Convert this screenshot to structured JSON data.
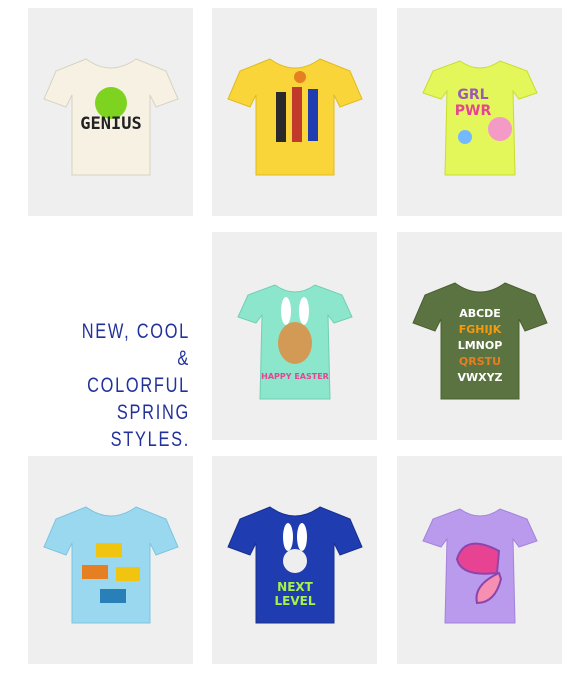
{
  "promo": {
    "line1": "NEW, COOL &",
    "line2": "COLORFUL",
    "line3": "SPRING STYLES."
  },
  "products": [
    {
      "name": "genius-tee",
      "color": "#f6f1e3",
      "graphic_text": "GENIUS"
    },
    {
      "name": "basketball-tee",
      "color": "#f9d53a"
    },
    {
      "name": "girl-pwr-tee",
      "color": "#e4f75a",
      "graphic_text": [
        "GRL",
        "PWR"
      ]
    },
    {
      "name": "happy-easter-cat-tee",
      "color": "#8ce6cc",
      "graphic_text": "HAPPY EASTER"
    },
    {
      "name": "alphabet-trucks-tee",
      "color": "#5a7340",
      "graphic_text": [
        "ABCDE",
        "FGHIJK",
        "LMNOP",
        "QRSTU",
        "VWXYZ"
      ]
    },
    {
      "name": "construction-trucks-tee",
      "color": "#9ad8f0"
    },
    {
      "name": "next-level-bunny-tee",
      "color": "#1f3cb0",
      "graphic_text": [
        "NEXT",
        "LEVEL"
      ]
    },
    {
      "name": "butterfly-tee",
      "color": "#b99aec"
    }
  ],
  "colors": {
    "tile_bg": "#efefef",
    "promo_text": "#23329a"
  }
}
